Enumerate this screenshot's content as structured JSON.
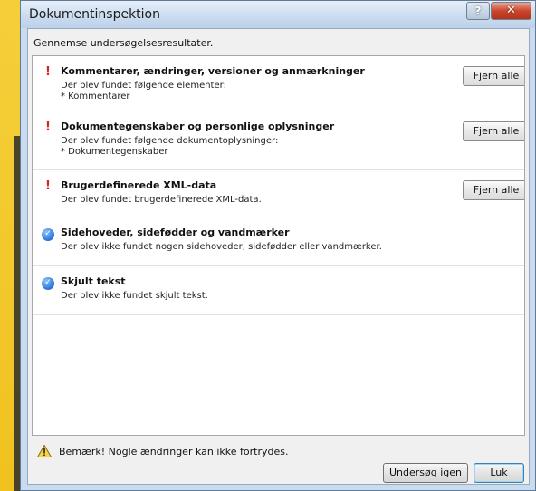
{
  "window": {
    "title": "Dokumentinspektion",
    "help_label": "?",
    "close_label": "✕"
  },
  "subtitle": "Gennemse undersøgelsesresultater.",
  "sections": [
    {
      "status": "warning",
      "heading": "Kommentarer, ændringer, versioner og anmærkninger",
      "desc": [
        "Der blev fundet følgende elementer:",
        "* Kommentarer"
      ],
      "button": "Fjern alle"
    },
    {
      "status": "warning",
      "heading": "Dokumentegenskaber og personlige oplysninger",
      "desc": [
        "Der blev fundet følgende dokumentoplysninger:",
        "* Dokumentegenskaber"
      ],
      "button": "Fjern alle"
    },
    {
      "status": "warning",
      "heading": "Brugerdefinerede XML-data",
      "desc": [
        "Der blev fundet brugerdefinerede XML-data."
      ],
      "button": "Fjern alle"
    },
    {
      "status": "ok",
      "heading": "Sidehoveder, sidefødder og vandmærker",
      "desc": [
        "Der blev ikke fundet nogen sidehoveder, sidefødder eller vandmærker."
      ]
    },
    {
      "status": "ok",
      "heading": "Skjult tekst",
      "desc": [
        "Der blev ikke fundet skjult tekst."
      ]
    }
  ],
  "footer": {
    "note": "Bemærk! Nogle ændringer kan ikke fortrydes.",
    "recheck_button": "Undersøg igen",
    "close_button": "Luk"
  },
  "colors": {
    "warning": "#d6261e",
    "ok": "#2f7ad9",
    "background": "#f4c930"
  },
  "icons": {
    "warning": "exclamation-icon",
    "ok": "check-icon",
    "footer": "warning-triangle-icon"
  }
}
